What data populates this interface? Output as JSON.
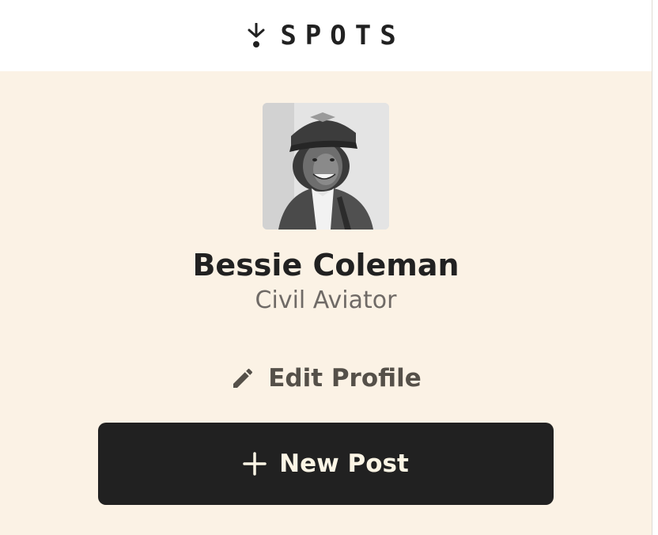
{
  "header": {
    "logo_text": "SPOTS",
    "logo_icon": "down-arrow-dot-icon"
  },
  "profile": {
    "name": "Bessie Coleman",
    "description": "Civil Aviator",
    "avatar_alt": "Bessie Coleman",
    "edit_label": "Edit Profile",
    "edit_icon": "pencil-icon"
  },
  "actions": {
    "new_post_label": "New Post",
    "new_post_icon": "plus-icon"
  },
  "colors": {
    "background": "#fbf2e5",
    "header_bg": "#ffffff",
    "text_primary": "#212121",
    "text_secondary": "#6f6a66",
    "button_bg": "#212121",
    "button_text": "#fcf5e5"
  }
}
